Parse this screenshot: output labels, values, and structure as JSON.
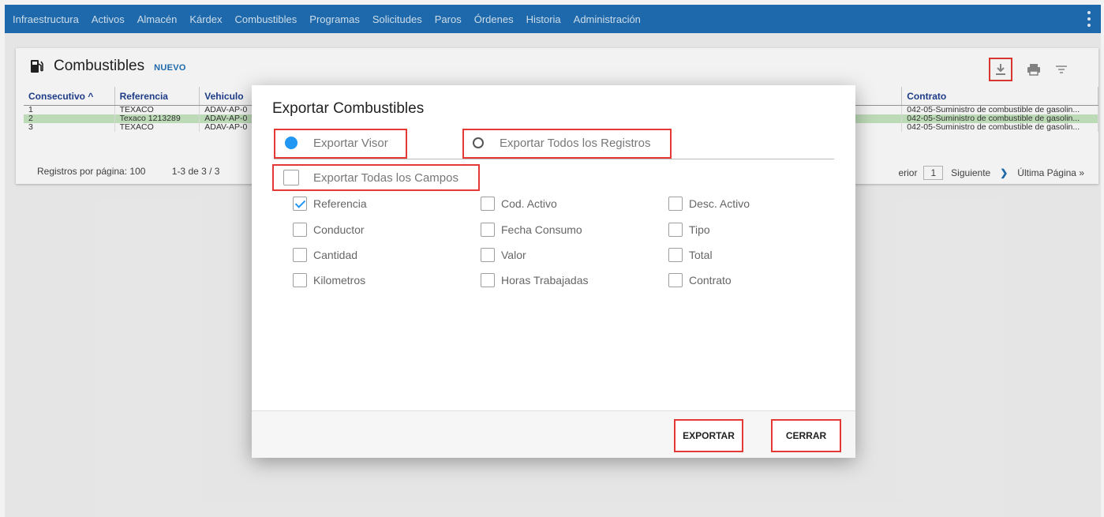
{
  "nav": {
    "items": [
      "Infraestructura",
      "Activos",
      "Almacén",
      "Kárdex",
      "Combustibles",
      "Programas",
      "Solicitudes",
      "Paros",
      "Órdenes",
      "Historia",
      "Administración"
    ]
  },
  "page": {
    "title": "Combustibles",
    "new_label": "NUEVO",
    "icons": {
      "title": "gas-pump-icon",
      "download": "download-icon",
      "print": "print-icon",
      "filter": "filter-icon"
    }
  },
  "table": {
    "headers": [
      "Consecutivo ^",
      "Referencia",
      "Vehiculo"
    ],
    "contract_header": "Contrato",
    "rows": [
      {
        "consecutivo": "1",
        "referencia": "TEXACO",
        "vehiculo": "ADAV-AP-0",
        "contrato": "042-05-Suministro de combustible de gasolin..."
      },
      {
        "consecutivo": "2",
        "referencia": "Texaco 1213289",
        "vehiculo": "ADAV-AP-0",
        "contrato": "042-05-Suministro de combustible de gasolin..."
      },
      {
        "consecutivo": "3",
        "referencia": "TEXACO",
        "vehiculo": "ADAV-AP-0",
        "contrato": "042-05-Suministro de combustible de gasolin..."
      }
    ],
    "highlight_row_color": "#c8e6c1"
  },
  "pagination": {
    "per_page_label": "Registros por página: 100",
    "range": "1-3 de 3 / 3",
    "prev_fragment": "erior",
    "current_page": "1",
    "next": "Siguiente",
    "last": "Última Página »"
  },
  "modal": {
    "title": "Exportar Combustibles",
    "radio_viewer": "Exportar Visor",
    "radio_all": "Exportar Todos los Registros",
    "all_fields": "Exportar Todas los Campos",
    "fields": [
      {
        "label": "Referencia",
        "checked": true
      },
      {
        "label": "Cod. Activo",
        "checked": false
      },
      {
        "label": "Desc. Activo",
        "checked": false
      },
      {
        "label": "Conductor",
        "checked": false
      },
      {
        "label": "Fecha Consumo",
        "checked": false
      },
      {
        "label": "Tipo",
        "checked": false
      },
      {
        "label": "Cantidad",
        "checked": false
      },
      {
        "label": "Valor",
        "checked": false
      },
      {
        "label": "Total",
        "checked": false
      },
      {
        "label": "Kilometros",
        "checked": false
      },
      {
        "label": "Horas Trabajadas",
        "checked": false
      },
      {
        "label": "Contrato",
        "checked": false
      }
    ],
    "export_button": "EXPORTAR",
    "close_button": "CERRAR"
  },
  "colors": {
    "nav_bg": "#1f6fb5",
    "accent": "#2196f3",
    "highlight_box": "#e53935"
  }
}
